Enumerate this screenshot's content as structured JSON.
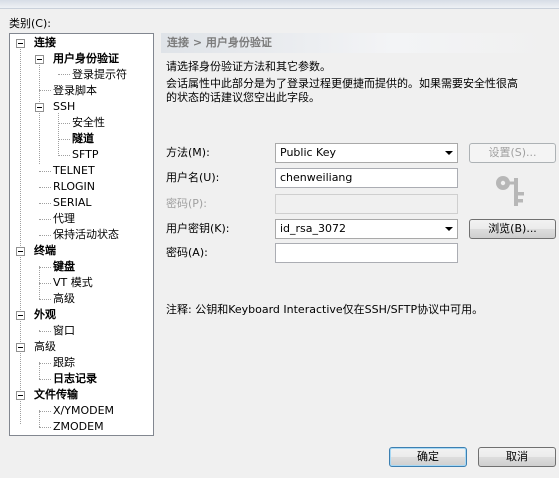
{
  "category_label": "类别(C):",
  "tree": {
    "items": [
      {
        "label": "连接",
        "bold": true
      },
      {
        "label": "用户身份验证",
        "bold": true
      },
      {
        "label": "登录提示符"
      },
      {
        "label": "登录脚本"
      },
      {
        "label": "SSH"
      },
      {
        "label": "安全性"
      },
      {
        "label": "隧道",
        "bold": true
      },
      {
        "label": "SFTP"
      },
      {
        "label": "TELNET"
      },
      {
        "label": "RLOGIN"
      },
      {
        "label": "SERIAL"
      },
      {
        "label": "代理"
      },
      {
        "label": "保持活动状态"
      },
      {
        "label": "终端",
        "bold": true
      },
      {
        "label": "键盘",
        "bold": true
      },
      {
        "label": "VT 模式"
      },
      {
        "label": "高级"
      },
      {
        "label": "外观",
        "bold": true
      },
      {
        "label": "窗口"
      },
      {
        "label": "高级"
      },
      {
        "label": "跟踪"
      },
      {
        "label": "日志记录",
        "bold": true
      },
      {
        "label": "文件传输",
        "bold": true
      },
      {
        "label": "X/YMODEM"
      },
      {
        "label": "ZMODEM"
      }
    ]
  },
  "header": {
    "breadcrumb": "连接 > 用户身份验证"
  },
  "description": {
    "line1": "请选择身份验证方法和其它参数。",
    "line2": "会话属性中此部分是为了登录过程更便捷而提供的。如果需要安全性很高",
    "line3": "的状态的话建议您空出此字段。"
  },
  "form": {
    "method_label": "方法(M):",
    "method_value": "Public Key",
    "settings_button": "设置(S)...",
    "username_label": "用户名(U):",
    "username_value": "chenweiliang",
    "password_label": "密码(P):",
    "password_value": "",
    "user_key_label": "用户密钥(K):",
    "user_key_value": "id_rsa_3072",
    "browse_button": "浏览(B)...",
    "passphrase_label": "密码(A):",
    "passphrase_value": ""
  },
  "note": "注释: 公钥和Keyboard Interactive仅在SSH/SFTP协议中可用。",
  "footer": {
    "ok_button": "确定",
    "cancel_button": "取消"
  },
  "colors": {
    "header_text": "#7c7c7c",
    "default_button_border": "#3c7fb1",
    "window_background": "#f0f0f0"
  },
  "icons": {
    "key": "key-icon"
  }
}
